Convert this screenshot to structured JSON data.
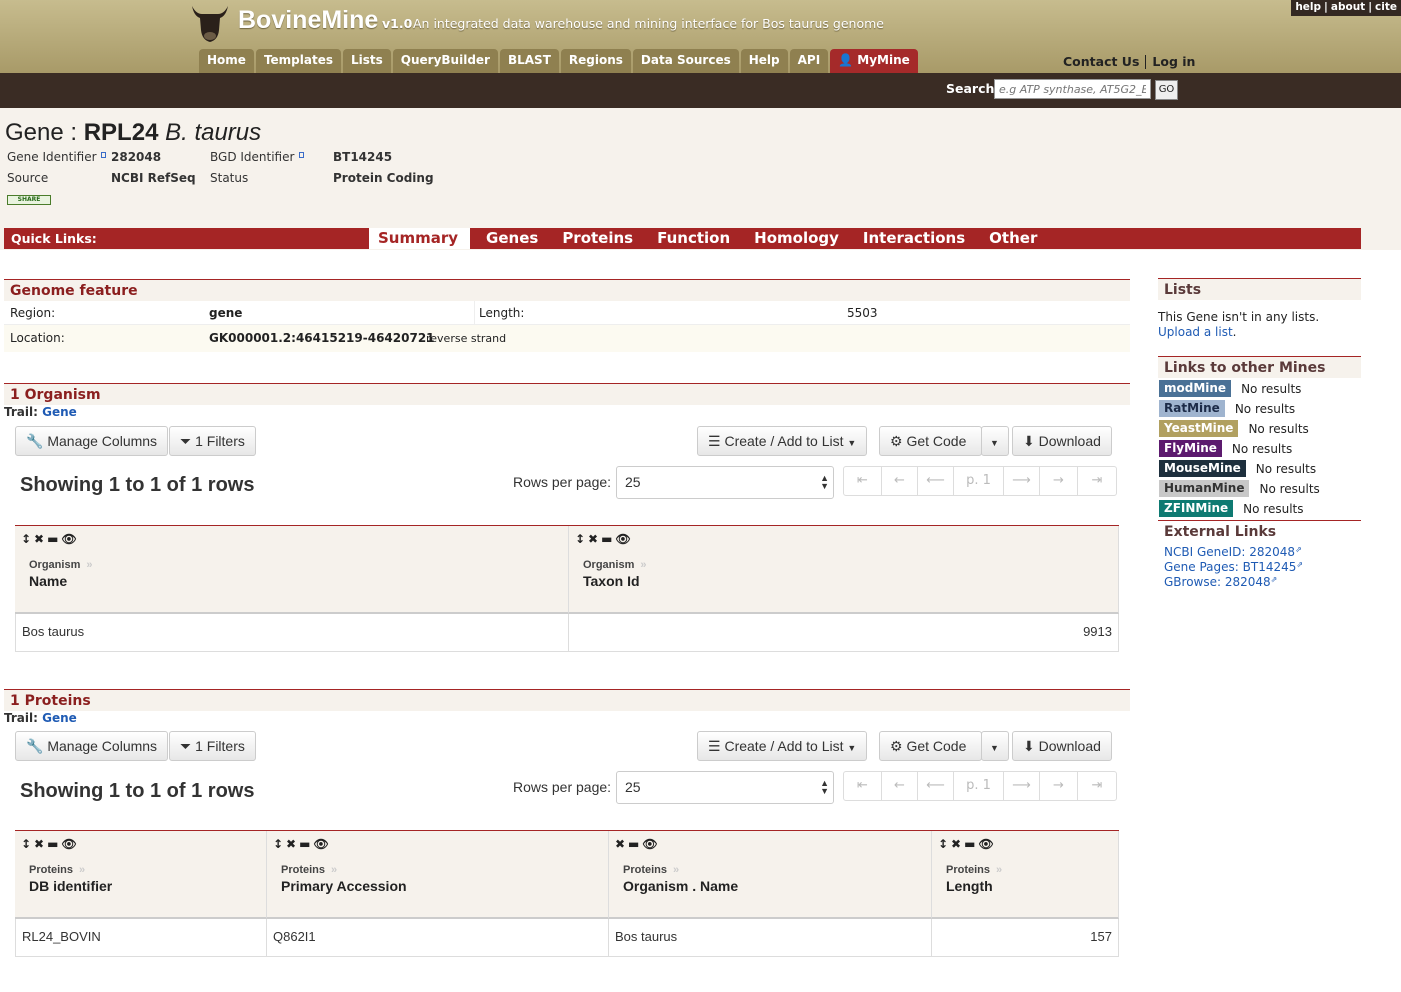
{
  "header": {
    "brand": "BovineMine",
    "version": "v1.0",
    "tagline": "An integrated data warehouse and mining interface for Bos taurus genome",
    "top_links": [
      "help",
      "about",
      "cite"
    ],
    "nav_tabs": [
      "Home",
      "Templates",
      "Lists",
      "QueryBuilder",
      "BLAST",
      "Regions",
      "Data Sources",
      "Help",
      "API",
      "MyMine"
    ],
    "contact": "Contact Us",
    "login": "Log in",
    "colors": {
      "header": "#b8ac7c",
      "tab": "#8f8050",
      "mymine": "#a52a2a",
      "searchbar": "#3a2c24"
    }
  },
  "search": {
    "label": "Search:",
    "placeholder": "e.g ATP synthase, AT5G2_E",
    "go": "GO"
  },
  "gene": {
    "prefix": "Gene :",
    "symbol": "RPL24",
    "organism": "B. taurus",
    "fields": {
      "gene_identifier_label": "Gene Identifier",
      "gene_identifier": "282048",
      "bgd_identifier_label": "BGD Identifier",
      "bgd_identifier": "BT14245",
      "source_label": "Source",
      "source": "NCBI RefSeq",
      "status_label": "Status",
      "status": "Protein Coding"
    },
    "share": "SHARE"
  },
  "quick_links": {
    "label": "Quick Links:",
    "tabs": [
      "Summary",
      "Genes",
      "Proteins",
      "Function",
      "Homology",
      "Interactions",
      "Other"
    ],
    "active": "Summary",
    "color": "#a52525"
  },
  "genome_feature": {
    "title": "Genome feature",
    "region_label": "Region:",
    "region": "gene",
    "length_label": "Length:",
    "length": "5503",
    "location_label": "Location:",
    "location": "GK000001.2:46415219-46420721",
    "strand": "reverse strand"
  },
  "organism_table": {
    "title": "1 Organism",
    "trail_label": "Trail:",
    "trail_link": "Gene",
    "buttons": {
      "manage_columns": "Manage Columns",
      "filters": "1 Filters",
      "create_list": "Create / Add to List",
      "get_code": "Get Code",
      "download": "Download"
    },
    "showing": "Showing 1 to 1 of 1 rows",
    "rows_per_page_label": "Rows per page:",
    "rows_per_page": "25",
    "pager": [
      "⇤",
      "←",
      "⟵",
      "p. 1",
      "⟶",
      "→",
      "⇥"
    ],
    "columns": [
      {
        "path": "Organism",
        "name": "Name",
        "icons": "↕✖▬👁"
      },
      {
        "path": "Organism",
        "name": "Taxon Id",
        "icons": "↕✖▬👁"
      }
    ],
    "rows": [
      [
        "Bos taurus",
        "9913"
      ]
    ]
  },
  "proteins_table": {
    "title": "1 Proteins",
    "trail_label": "Trail:",
    "trail_link": "Gene",
    "buttons": {
      "manage_columns": "Manage Columns",
      "filters": "1 Filters",
      "create_list": "Create / Add to List",
      "get_code": "Get Code",
      "download": "Download"
    },
    "showing": "Showing 1 to 1 of 1 rows",
    "rows_per_page_label": "Rows per page:",
    "rows_per_page": "25",
    "pager": [
      "⇤",
      "←",
      "⟵",
      "p. 1",
      "⟶",
      "→",
      "⇥"
    ],
    "columns": [
      {
        "path": "Proteins",
        "name": "DB identifier",
        "icons": "↕✖▬👁"
      },
      {
        "path": "Proteins",
        "name": "Primary Accession",
        "icons": "↕✖▬👁"
      },
      {
        "path": "Proteins",
        "name": "Organism . Name",
        "icons": "✖▬👁"
      },
      {
        "path": "Proteins",
        "name": "Length",
        "icons": "↕✖▬👁"
      }
    ],
    "rows": [
      [
        "RL24_BOVIN",
        "Q862I1",
        "Bos taurus",
        "157"
      ]
    ]
  },
  "sidebar": {
    "lists_title": "Lists",
    "lists_text": "This Gene isn't in any lists.",
    "lists_link": "Upload a list",
    "other_mines_title": "Links to other Mines",
    "mines": [
      {
        "name": "modMine",
        "result": "No results",
        "color": "#4a7196"
      },
      {
        "name": "RatMine",
        "result": "No results",
        "color": "#9fb4cf"
      },
      {
        "name": "YeastMine",
        "result": "No results",
        "color": "#b1a060"
      },
      {
        "name": "FlyMine",
        "result": "No results",
        "color": "#5c1a6e"
      },
      {
        "name": "MouseMine",
        "result": "No results",
        "color": "#1d2f3d"
      },
      {
        "name": "HumanMine",
        "result": "No results",
        "color": "#c8c8c8"
      },
      {
        "name": "ZFINMine",
        "result": "No results",
        "color": "#0e7a72"
      }
    ],
    "external_title": "External Links",
    "external_links": [
      "NCBI GeneID: 282048",
      "Gene Pages: BT14245",
      "GBrowse: 282048"
    ]
  }
}
